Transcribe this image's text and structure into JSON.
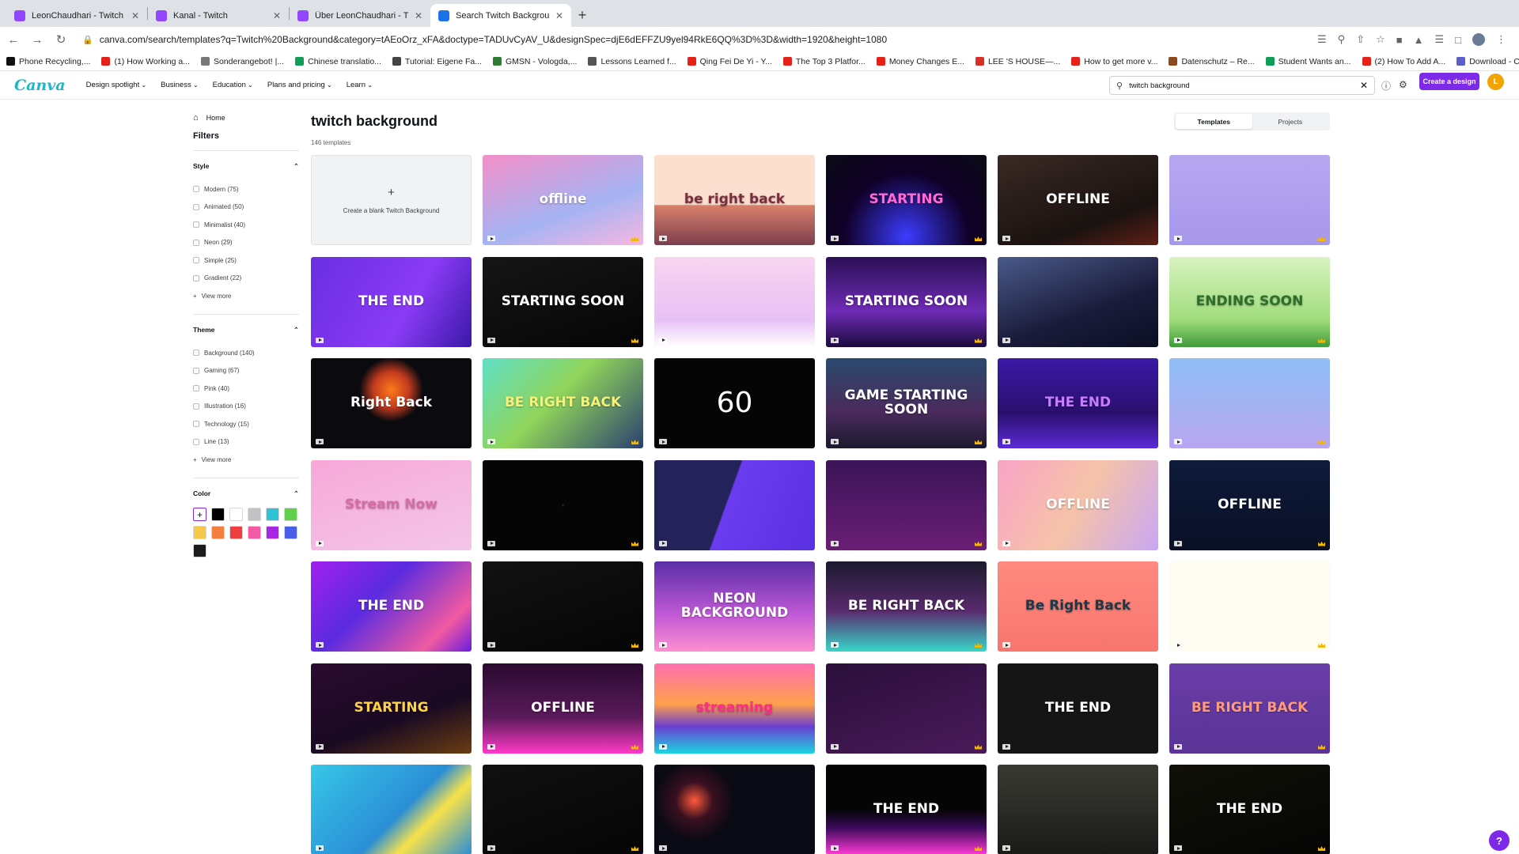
{
  "browser": {
    "tabs": [
      {
        "title": "LeonChaudhari - Twitch",
        "color": "#9146ff"
      },
      {
        "title": "Kanal - Twitch",
        "color": "#9146ff"
      },
      {
        "title": "Über LeonChaudhari - Twitch",
        "color": "#9146ff"
      },
      {
        "title": "Search Twitch Background - C",
        "color": "#1a73e8"
      }
    ],
    "url": "canva.com/search/templates?q=Twitch%20Background&category=tAEoOrz_xFA&doctype=TADUvCyAV_U&designSpec=djE6dEFFZU9yel94RkE6QQ%3D%3D&width=1920&height=1080",
    "bookmarks": [
      {
        "label": "Phone Recycling,...",
        "color": "#111111"
      },
      {
        "label": "(1) How Working a...",
        "color": "#e62117"
      },
      {
        "label": "Sonderangebot! |...",
        "color": "#777777"
      },
      {
        "label": "Chinese translatio...",
        "color": "#0f9d58"
      },
      {
        "label": "Tutorial: Eigene Fa...",
        "color": "#444444"
      },
      {
        "label": "GMSN - Vologda,...",
        "color": "#2e7d32"
      },
      {
        "label": "Lessons Learned f...",
        "color": "#555555"
      },
      {
        "label": "Qing Fei De Yi - Y...",
        "color": "#e62117"
      },
      {
        "label": "The Top 3 Platfor...",
        "color": "#e62117"
      },
      {
        "label": "Money Changes E...",
        "color": "#e62117"
      },
      {
        "label": "LEE 'S HOUSE—...",
        "color": "#d93025"
      },
      {
        "label": "How to get more v...",
        "color": "#e62117"
      },
      {
        "label": "Datenschutz – Re...",
        "color": "#8d4a1a"
      },
      {
        "label": "Student Wants an...",
        "color": "#0f9d58"
      },
      {
        "label": "(2) How To Add A...",
        "color": "#e62117"
      },
      {
        "label": "Download - Cooki...",
        "color": "#5b5fc7"
      }
    ]
  },
  "header": {
    "logo": "Canva",
    "menu": [
      "Design spotlight",
      "Business",
      "Education",
      "Plans and pricing",
      "Learn"
    ],
    "search_value": "twitch background",
    "create_label": "Create a design",
    "avatar_letter": "L"
  },
  "sidebar": {
    "home": "Home",
    "filters": "Filters",
    "style": {
      "title": "Style",
      "items": [
        "Modern (75)",
        "Animated (50)",
        "Minimalist (40)",
        "Neon (29)",
        "Simple (25)",
        "Gradient (22)"
      ],
      "view_more": "View more"
    },
    "theme": {
      "title": "Theme",
      "items": [
        "Background (140)",
        "Gaming (67)",
        "Pink (40)",
        "Illustration (16)",
        "Technology (15)",
        "Line (13)"
      ],
      "view_more": "View more"
    },
    "color": {
      "title": "Color",
      "swatches": [
        "#ffffff",
        "#000000",
        "#ffffff",
        "#c0c2c6",
        "#2ec4d6",
        "#5fcf4c",
        "#f7c948",
        "#f47f3f",
        "#ef3e3e",
        "#f35aa6",
        "#a925e6",
        "#4a5ee8",
        "#1c1c1c"
      ]
    }
  },
  "main": {
    "title": "twitch background",
    "count": "146 templates",
    "tabs": [
      "Templates",
      "Projects"
    ],
    "blank_label": "Create a blank Twitch Background",
    "tiles": [
      {
        "t": "",
        "bg": "#f1f2f4",
        "fg": "#333333"
      },
      {
        "t": "offline",
        "bg": "linear-gradient(160deg,#f48fc9,#a5b3f3 60%,#f7b7e0)",
        "fg": "#ffffff"
      },
      {
        "t": "be right back",
        "bg": "linear-gradient(180deg,#fbe0cf 55%,#d8806a 56%,#7c3e4d)",
        "fg": "#7a2d3d"
      },
      {
        "t": "STARTING",
        "bg": "radial-gradient(ellipse at 50% 90%,#3c3cff 0,#100028 55%,#0a0a14)",
        "fg": "#ff6ad5"
      },
      {
        "t": "OFFLINE",
        "bg": "linear-gradient(160deg,#3a2a24,#1a1210 70%,#602015)",
        "fg": "#ffffff"
      },
      {
        "t": "",
        "bg": "linear-gradient(180deg,#b7a6f0,#a898ec)",
        "fg": "#ffffff"
      },
      {
        "t": "THE END",
        "bg": "linear-gradient(120deg,#6a2ee0,#8a3bf5 60%,#3a18a8)",
        "fg": "#ffffff"
      },
      {
        "t": "STARTING SOON",
        "bg": "linear-gradient(160deg,#161616,#050505)",
        "fg": "#ffffff"
      },
      {
        "t": "",
        "bg": "linear-gradient(180deg,#f8d5f0,#e7c1f5 70%,#ffffff)",
        "fg": "#ffffff"
      },
      {
        "t": "STARTING SOON",
        "bg": "linear-gradient(180deg,#2a0f55,#6f2bb5 60%,#1b0b3d)",
        "fg": "#ffffff"
      },
      {
        "t": "",
        "bg": "linear-gradient(160deg,#4a5a8a,#1a1b3a 60%,#0c0e24)",
        "fg": "#ffffff"
      },
      {
        "t": "ENDING SOON",
        "bg": "linear-gradient(180deg,#d9f3c2,#9fdc7a 70%,#3f9a3a)",
        "fg": "#2c6e2c"
      },
      {
        "t": "Right Back",
        "bg": "radial-gradient(circle at 50% 35%,#ff7a1a 0,#c23b1f 18%,#0b0b0f 32%)",
        "fg": "#ffffff"
      },
      {
        "t": "BE RIGHT BACK",
        "bg": "linear-gradient(135deg,#5fe0c5,#90d45a 45%,#2a3f70)",
        "fg": "#f4f27a"
      },
      {
        "t": "60",
        "bg": "#050505",
        "fg": "#ffffff"
      },
      {
        "t": "GAME STARTING SOON",
        "bg": "linear-gradient(180deg,#2b4a6e,#4a2a5c 60%,#1a1a2e)",
        "fg": "#ffffff"
      },
      {
        "t": "THE END",
        "bg": "linear-gradient(180deg,#3b1aa8,#2a0f6e 60%,#5b2bd6)",
        "fg": "#c77dff"
      },
      {
        "t": "",
        "bg": "linear-gradient(180deg,#8fbff5,#b8a6f0)",
        "fg": "#ffffff"
      },
      {
        "t": "Stream Now",
        "bg": "linear-gradient(160deg,#f7a8d8,#f3c6e8)",
        "fg": "#d86aa8"
      },
      {
        "t": "",
        "bg": "radial-gradient(circle,#202020 1px,#050505 2px)",
        "fg": "#ffffff"
      },
      {
        "t": "",
        "bg": "linear-gradient(110deg,#23235a 45%,#6b3cf0 46%,#5a30e0)",
        "fg": "#ffffff"
      },
      {
        "t": "",
        "bg": "linear-gradient(180deg,#3b1458,#6a1e75)",
        "fg": "#ffffff"
      },
      {
        "t": "OFFLINE",
        "bg": "linear-gradient(120deg,#f9a3c7,#f6c3a8 50%,#c9a7f3)",
        "fg": "#ffffff"
      },
      {
        "t": "OFFLINE",
        "bg": "linear-gradient(180deg,#0e1a3a,#0a1126)",
        "fg": "#ffffff"
      },
      {
        "t": "THE END",
        "bg": "linear-gradient(135deg,#a020f0,#5b2be0 40%,#f05aa0 80%,#6a1de0)",
        "fg": "#ffffff"
      },
      {
        "t": "",
        "bg": "linear-gradient(160deg,#121212,#050505)",
        "fg": "#ffffff"
      },
      {
        "t": "NEON BACKGROUND",
        "bg": "linear-gradient(180deg,#5a2ea8,#c25ad6 60%,#ff8fd0)",
        "fg": "#ffffff"
      },
      {
        "t": "BE RIGHT BACK",
        "bg": "linear-gradient(180deg,#1a1a2e,#5a2a6e 55%,#38d6c8)",
        "fg": "#ffffff"
      },
      {
        "t": "Be Right Back",
        "bg": "linear-gradient(180deg,#ff8a80,#f7766d)",
        "fg": "#1a3a4a"
      },
      {
        "t": "",
        "bg": "#fffdf2",
        "fg": "#111111"
      },
      {
        "t": "STARTING",
        "bg": "linear-gradient(160deg,#2a0b30,#1a0a22 60%,#6a3d10)",
        "fg": "#ffd23f"
      },
      {
        "t": "OFFLINE",
        "bg": "linear-gradient(180deg,#2a0a30,#5a1a5a 60%,#ff3ac8)",
        "fg": "#ffffff"
      },
      {
        "t": "streaming",
        "bg": "linear-gradient(180deg,#ff6fb0,#ffa04a 45%,#6a3ed0 70%,#1ad6e0)",
        "fg": "#ff2a8a"
      },
      {
        "t": "",
        "bg": "linear-gradient(160deg,#2a0f3a,#4a1a5a)",
        "fg": "#ffffff"
      },
      {
        "t": "THE END",
        "bg": "#151515",
        "fg": "#ffffff"
      },
      {
        "t": "BE RIGHT BACK",
        "bg": "linear-gradient(180deg,#6a3ea8,#5a3496)",
        "fg": "#ff9a7a"
      },
      {
        "t": "",
        "bg": "linear-gradient(135deg,#37c8e8,#2a8ed6 55%,#f7e24a 70%,#2a8ed6)",
        "fg": "#ffffff"
      },
      {
        "t": "",
        "bg": "linear-gradient(160deg,#101010,#050505)",
        "fg": "#f7e24a"
      },
      {
        "t": "",
        "bg": "radial-gradient(circle at 25% 40%,#ff5a3a 0,#3a1020 14%,#0a0a14 30%)",
        "fg": "#ffffff"
      },
      {
        "t": "THE END",
        "bg": "linear-gradient(180deg,#050505 50%,#3a0a5a 70%,#ff3ad6)",
        "fg": "#ffffff"
      },
      {
        "t": "",
        "bg": "linear-gradient(180deg,#3a3a34,#1a1a18)",
        "fg": "#aaaaaa"
      },
      {
        "t": "THE END",
        "bg": "linear-gradient(160deg,#101008,#050505)",
        "fg": "#ffffff"
      }
    ]
  }
}
